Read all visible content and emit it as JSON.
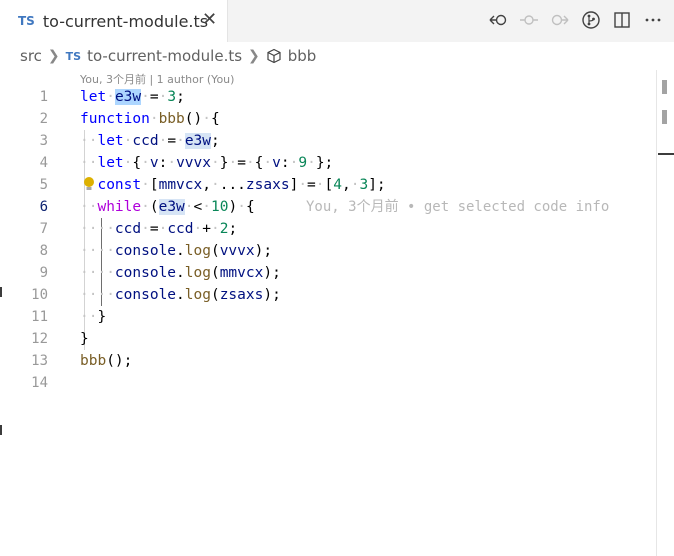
{
  "tab": {
    "badge": "TS",
    "filename": "to-current-module.ts",
    "close": "✕"
  },
  "toolbar": {
    "actions": [
      {
        "icon": "go-back-icon"
      },
      {
        "icon": "commit-node-icon"
      },
      {
        "icon": "go-forward-icon"
      },
      {
        "icon": "git-compare-icon"
      },
      {
        "icon": "split-editor-icon"
      },
      {
        "icon": "more-actions-icon"
      }
    ]
  },
  "breadcrumb": {
    "folder": "src",
    "file_badge": "TS",
    "file": "to-current-module.ts",
    "symbol": "bbb"
  },
  "blame": {
    "header": "You, 3个月前 | 1 author (You)",
    "inline": "You, 3个月前 • get selected code info"
  },
  "editor": {
    "active_line": 6,
    "lines": [
      {
        "n": "1"
      },
      {
        "n": "2"
      },
      {
        "n": "3"
      },
      {
        "n": "4"
      },
      {
        "n": "5"
      },
      {
        "n": "6"
      },
      {
        "n": "7"
      },
      {
        "n": "8"
      },
      {
        "n": "9"
      },
      {
        "n": "10"
      },
      {
        "n": "11"
      },
      {
        "n": "12"
      },
      {
        "n": "13"
      },
      {
        "n": "14"
      }
    ],
    "tokens": {
      "let": "let",
      "function": "function",
      "const": "const",
      "while": "while",
      "e3w": "e3w",
      "bbb": "bbb",
      "ccd": "ccd",
      "v": "v",
      "vvvx": "vvvx",
      "mmvcx": "mmvcx",
      "zsaxs": "zsaxs",
      "console": "console",
      "log": "log",
      "n3": "3",
      "n9": "9",
      "n4": "4",
      "n10": "10",
      "n2": "2"
    }
  },
  "colors": {
    "keyword": "#0000ff",
    "control": "#af00db",
    "function": "#795e26",
    "variable": "#001080",
    "number": "#098658",
    "highlight": "#add6ff"
  }
}
